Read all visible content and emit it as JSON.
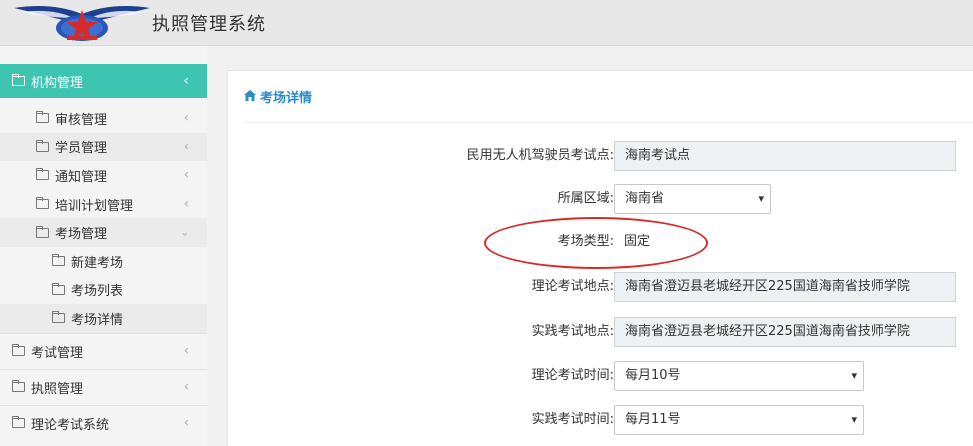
{
  "app": {
    "title": "执照管理系统"
  },
  "sidebar": {
    "active": {
      "label": "机构管理",
      "chevron": "‹"
    },
    "items": [
      {
        "label": "审核管理",
        "chevron": "‹"
      },
      {
        "label": "学员管理",
        "chevron": "‹"
      },
      {
        "label": "通知管理",
        "chevron": "‹"
      },
      {
        "label": "培训计划管理",
        "chevron": "‹"
      },
      {
        "label": "考场管理",
        "chevron": "⌄"
      }
    ],
    "subitems": [
      {
        "label": "新建考场"
      },
      {
        "label": "考场列表"
      },
      {
        "label": "考场详情"
      }
    ],
    "top_items": [
      {
        "label": "考试管理",
        "chevron": "‹"
      },
      {
        "label": "执照管理",
        "chevron": "‹"
      },
      {
        "label": "理论考试系统",
        "chevron": "‹"
      }
    ]
  },
  "panel": {
    "title": "考场详情",
    "home_icon": "home-icon"
  },
  "form": {
    "site_name": {
      "label": "民用无人机驾驶员考试点:",
      "value": "海南考试点"
    },
    "region": {
      "label": "所属区域:",
      "value": "海南省"
    },
    "site_type": {
      "label": "考场类型:",
      "value": "固定"
    },
    "theory_location": {
      "label": "理论考试地点:",
      "value": "海南省澄迈县老城经开区225国道海南省技师学院"
    },
    "practice_location": {
      "label": "实践考试地点:",
      "value": "海南省澄迈县老城经开区225国道海南省技师学院"
    },
    "theory_time": {
      "label": "理论考试时间:",
      "value": "每月10号"
    },
    "practice_time": {
      "label": "实践考试时间:",
      "value": "每月11号"
    }
  },
  "colors": {
    "accent": "#3ec5b1",
    "link": "#2b8cc4",
    "annotation": "#d62b2b"
  }
}
